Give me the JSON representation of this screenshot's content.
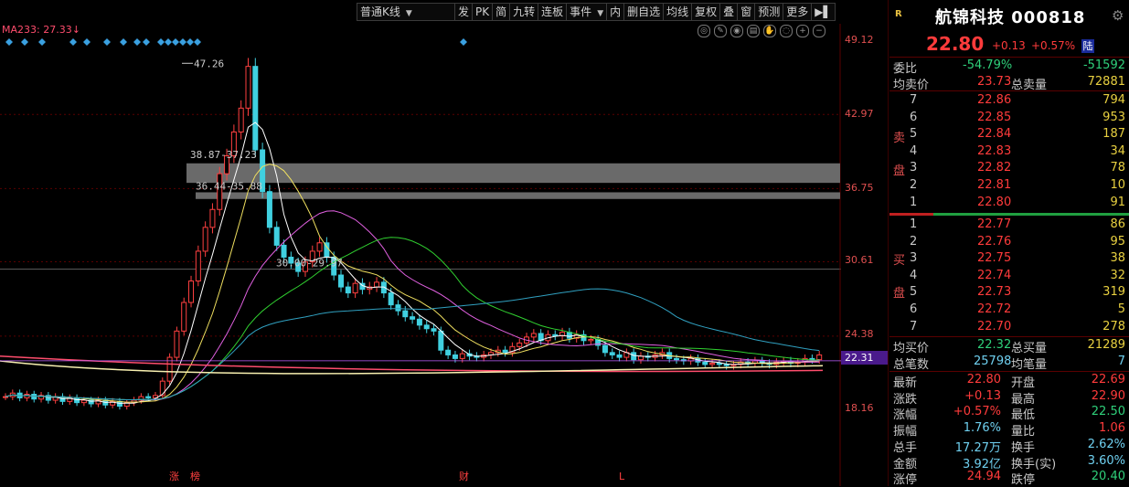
{
  "toolbar": {
    "items": [
      "普通K线",
      "发",
      "PK",
      "简",
      "九转",
      "连板",
      "事件",
      "内",
      "删自选",
      "均线",
      "复权",
      "叠",
      "窗",
      "预测",
      "更多",
      "▶▌"
    ]
  },
  "chart": {
    "ma_label": "MA233: 27.33↓",
    "ma_color": "#ff4d6d",
    "axis_labels": [
      "49.12",
      "42.97",
      "36.75",
      "30.61",
      "24.38",
      "18.16"
    ],
    "current_price": "22.31",
    "annotations": {
      "peak": "47.26",
      "gap1": "38.87-37.23",
      "gap2": "36.44-35.88",
      "gap3": "30.00-29.97"
    },
    "bottom_marks": [
      "涨",
      "榜",
      "财",
      "L"
    ],
    "tool_icons": [
      "target-icon",
      "pencil-icon",
      "eye-icon",
      "chart-icon",
      "hand-icon",
      "eye-off-icon",
      "zoom-in-icon",
      "zoom-out-icon"
    ]
  },
  "quote": {
    "badge": "R",
    "name": "航锦科技 000818",
    "last": "22.80",
    "change": "+0.13",
    "change_pct": "+0.57%",
    "market": "陆",
    "weibi_label": "委比",
    "weibi_pct": "-54.79%",
    "weibi_val": "-51592",
    "avg_sell_label": "均卖价",
    "avg_sell": "23.73",
    "total_sell_label": "总卖量",
    "total_sell": "72881",
    "sell_side_a": "卖",
    "sell_side_b": "盘",
    "buy_side_a": "买",
    "buy_side_b": "盘",
    "asks": [
      {
        "lvl": "7",
        "price": "22.86",
        "vol": "794"
      },
      {
        "lvl": "6",
        "price": "22.85",
        "vol": "953"
      },
      {
        "lvl": "5",
        "price": "22.84",
        "vol": "187"
      },
      {
        "lvl": "4",
        "price": "22.83",
        "vol": "34"
      },
      {
        "lvl": "3",
        "price": "22.82",
        "vol": "78"
      },
      {
        "lvl": "2",
        "price": "22.81",
        "vol": "10"
      },
      {
        "lvl": "1",
        "price": "22.80",
        "vol": "91"
      }
    ],
    "bids": [
      {
        "lvl": "1",
        "price": "22.77",
        "vol": "86"
      },
      {
        "lvl": "2",
        "price": "22.76",
        "vol": "95"
      },
      {
        "lvl": "3",
        "price": "22.75",
        "vol": "38"
      },
      {
        "lvl": "4",
        "price": "22.74",
        "vol": "32"
      },
      {
        "lvl": "5",
        "price": "22.73",
        "vol": "319"
      },
      {
        "lvl": "6",
        "price": "22.72",
        "vol": "5"
      },
      {
        "lvl": "7",
        "price": "22.70",
        "vol": "278"
      }
    ],
    "avg_buy_label": "均买价",
    "avg_buy": "22.32",
    "total_buy_label": "总买量",
    "total_buy": "21289",
    "total_deals_label": "总笔数",
    "total_deals": "25798",
    "avg_deal_label": "均笔量",
    "avg_deal": "7",
    "stats": [
      {
        "l1": "最新",
        "v1": "22.80",
        "c1": "red",
        "l2": "开盘",
        "v2": "22.69",
        "c2": "red"
      },
      {
        "l1": "涨跌",
        "v1": "+0.13",
        "c1": "red",
        "l2": "最高",
        "v2": "22.90",
        "c2": "red"
      },
      {
        "l1": "涨幅",
        "v1": "+0.57%",
        "c1": "red",
        "l2": "最低",
        "v2": "22.50",
        "c2": "green"
      },
      {
        "l1": "振幅",
        "v1": "1.76%",
        "c1": "num",
        "l2": "量比",
        "v2": "1.06",
        "c2": "red"
      },
      {
        "l1": "总手",
        "v1": "17.27万",
        "c1": "num",
        "l2": "换手",
        "v2": "2.62%",
        "c2": "num"
      },
      {
        "l1": "金额",
        "v1": "3.92亿",
        "c1": "num",
        "l2": "换手(实)",
        "v2": "3.60%",
        "c2": "num"
      },
      {
        "l1": "涨停",
        "v1": "24.94",
        "c1": "red",
        "l2": "跌停",
        "v2": "20.40",
        "c2": "green"
      }
    ]
  }
}
